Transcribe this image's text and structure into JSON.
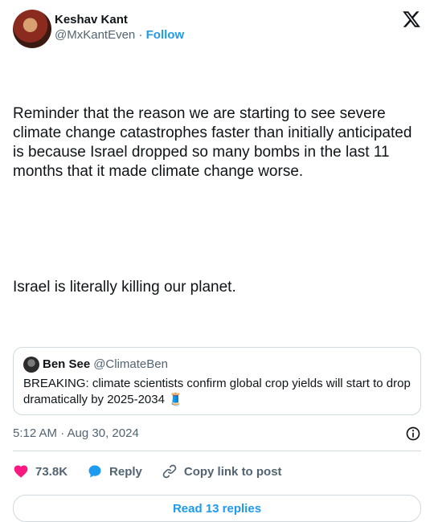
{
  "author": {
    "display_name": "Keshav Kant",
    "handle": "@MxKantEven",
    "separator": " · ",
    "follow_label": "Follow"
  },
  "tweet": {
    "paragraph1": "Reminder that the reason we are starting to see severe climate change catastrophes faster than initially anticipated is because Israel dropped so many bombs in the last 11 months that it made climate change worse.",
    "paragraph2": "Israel is literally killing our planet."
  },
  "quoted_tweet": {
    "display_name": "Ben See",
    "handle": "@ClimateBen",
    "text": "BREAKING:  climate scientists confirm global crop yields will start to drop dramatically by 2025-2034 🧵"
  },
  "meta": {
    "timestamp": "5:12 AM · Aug 30, 2024"
  },
  "actions": {
    "like_count": "73.8K",
    "reply_label": "Reply",
    "copy_link_label": "Copy link to post"
  },
  "footer": {
    "read_replies_label": "Read 13 replies"
  },
  "colors": {
    "accent": "#1d9bf0",
    "like": "#f91880",
    "text_primary": "#0f1419",
    "text_secondary": "#536471",
    "border": "#cfd9de"
  },
  "icons": {
    "brand": "x-logo-icon",
    "like": "heart-icon",
    "reply": "speech-bubble-icon",
    "copy_link": "link-icon",
    "info": "info-icon"
  }
}
